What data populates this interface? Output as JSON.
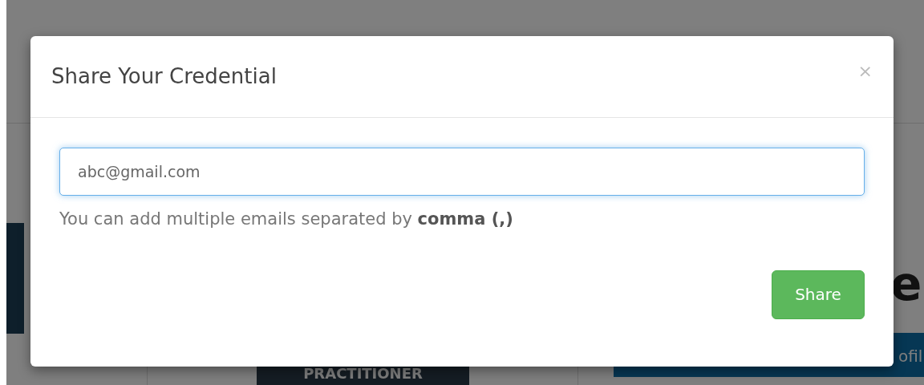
{
  "background": {
    "badge": "PRACTITIONER",
    "heading_fragment": "e",
    "button_fragment": "ofil"
  },
  "modal": {
    "title": "Share Your Credential",
    "close": "×",
    "email_field": {
      "value": "abc@gmail.com",
      "focused": true
    },
    "help_text": "You can add multiple emails separated by **comma (,)**",
    "share_button": "Share"
  }
}
